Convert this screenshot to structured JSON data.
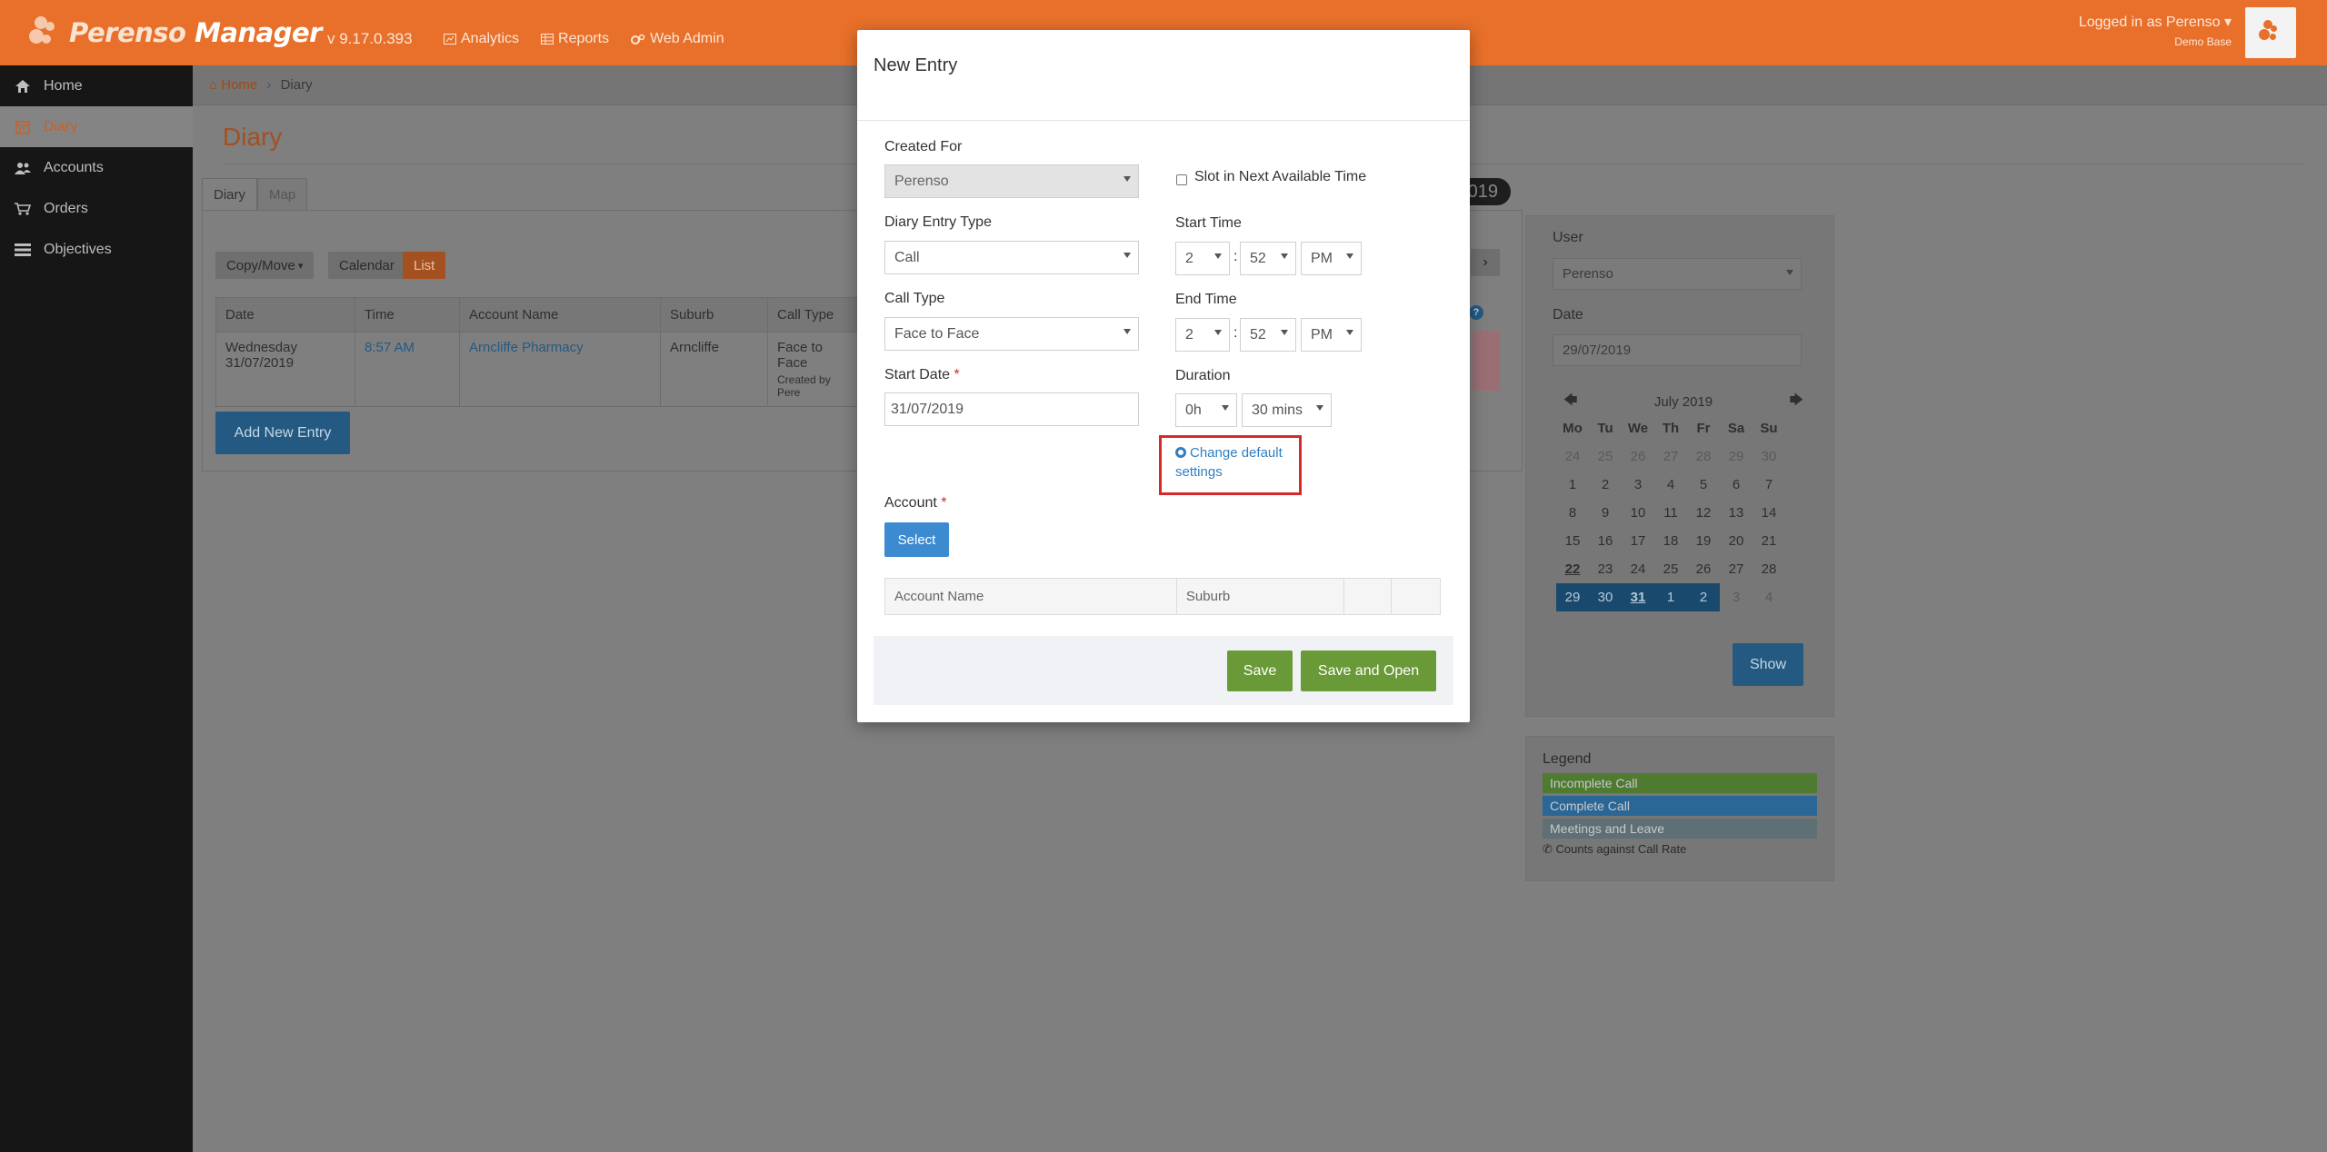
{
  "app": {
    "brand_word1": "Perenso",
    "brand_word2": "Manager",
    "version": "v 9.17.0.393",
    "nav": [
      {
        "label": "Analytics",
        "icon": "chart-icon"
      },
      {
        "label": "Reports",
        "icon": "table-icon"
      },
      {
        "label": "Web Admin",
        "icon": "gears-icon"
      }
    ],
    "login_text": "Logged in as Perenso",
    "login_sub": "Demo Base"
  },
  "sidebar": {
    "items": [
      {
        "label": "Home",
        "icon": "home-icon"
      },
      {
        "label": "Diary",
        "icon": "calendar-icon"
      },
      {
        "label": "Accounts",
        "icon": "users-icon"
      },
      {
        "label": "Orders",
        "icon": "cart-icon"
      },
      {
        "label": "Objectives",
        "icon": "list-icon"
      }
    ]
  },
  "page": {
    "breadcrumb_home": "Home",
    "breadcrumb_current": "Diary",
    "title": "Diary",
    "tabs": [
      "Diary",
      "Map"
    ],
    "copy_move": "Copy/Move",
    "view_calendar": "Calendar",
    "view_list": "List",
    "table_headers": [
      "Date",
      "Time",
      "Account Name",
      "Suburb",
      "Call Type"
    ],
    "row": {
      "date_line1": "Wednesday",
      "date_line2": "31/07/2019",
      "time": "8:57 AM",
      "account": "Arncliffe Pharmacy",
      "suburb": "Arncliffe",
      "call_type": "Face to Face",
      "created_by": "Created by Pere"
    },
    "add_button": "Add New Entry",
    "date_pill": "019",
    "next_arrow": "›",
    "help_glyph": "?"
  },
  "right_panel": {
    "user_label": "User",
    "user_value": "Perenso",
    "date_label": "Date",
    "date_value": "29/07/2019",
    "calendar": {
      "month": "July 2019",
      "prev": "🡄",
      "next": "🡆",
      "dow": [
        "Mo",
        "Tu",
        "We",
        "Th",
        "Fr",
        "Sa",
        "Su"
      ],
      "weeks": [
        [
          "24",
          "25",
          "26",
          "27",
          "28",
          "29",
          "30"
        ],
        [
          "1",
          "2",
          "3",
          "4",
          "5",
          "6",
          "7"
        ],
        [
          "8",
          "9",
          "10",
          "11",
          "12",
          "13",
          "14"
        ],
        [
          "15",
          "16",
          "17",
          "18",
          "19",
          "20",
          "21"
        ],
        [
          "22",
          "23",
          "24",
          "25",
          "26",
          "27",
          "28"
        ],
        [
          "29",
          "30",
          "31",
          "1",
          "2",
          "3",
          "4"
        ]
      ]
    },
    "show_button": "Show"
  },
  "legend": {
    "title": "Legend",
    "items": [
      {
        "label": "Incomplete Call",
        "color": "#4f7a31"
      },
      {
        "label": "Complete Call",
        "color": "#2a6797"
      },
      {
        "label": "Meetings and Leave",
        "color": "#5f6f76"
      }
    ],
    "note": "Counts against Call Rate"
  },
  "modal": {
    "title": "New Entry",
    "created_for_label": "Created For",
    "created_for_value": "Perenso",
    "slot_label": "Slot in Next Available Time",
    "entry_type_label": "Diary Entry Type",
    "entry_type_value": "Call",
    "start_time_label": "Start Time",
    "start_hour": "2",
    "start_min": "52",
    "start_ampm": "PM",
    "call_type_label": "Call Type",
    "call_type_value": "Face to Face",
    "end_time_label": "End Time",
    "end_hour": "2",
    "end_min": "52",
    "end_ampm": "PM",
    "start_date_label": "Start Date",
    "start_date_value": "31/07/2019",
    "duration_label": "Duration",
    "duration_hours": "0h",
    "duration_mins": "30 mins",
    "change_defaults": "Change default settings",
    "account_label": "Account",
    "required_mark": "*",
    "time_sep": ":",
    "select_button": "Select",
    "account_headers": [
      "Account Name",
      "Suburb",
      "",
      ""
    ],
    "save_button": "Save",
    "save_open_button": "Save and Open"
  },
  "colors": {
    "brand": "#e8702a",
    "accent_blue": "#3c8ad0",
    "save_green": "#6a9a37",
    "highlight_red": "#d62929"
  }
}
